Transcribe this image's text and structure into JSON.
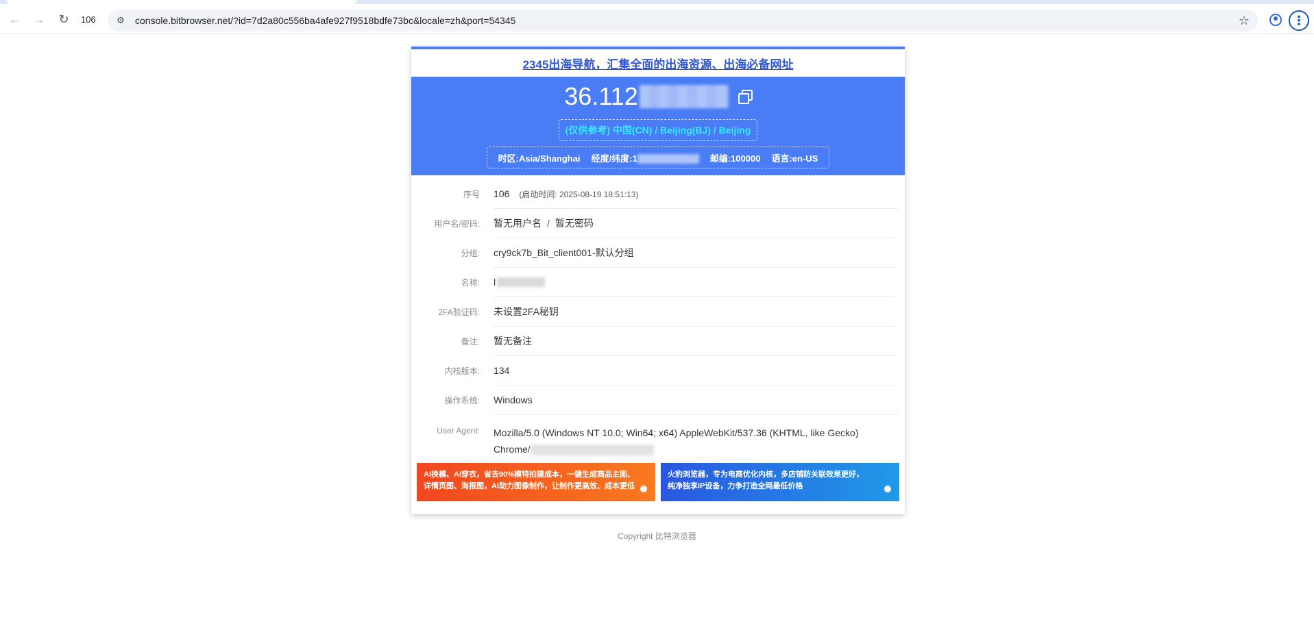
{
  "browser": {
    "tab_number": "106",
    "url": "console.bitbrowser.net/?id=7d2a80c556ba4afe927f9518bdfe73bc&locale=zh&port=54345"
  },
  "card": {
    "top_link": "2345出海导航，汇集全面的出海资源、出海必备网址",
    "ip_prefix": "36.112",
    "location": "(仅供参考) 中国(CN) / Beijing(BJ) / Beijing",
    "timezone": "时区:Asia/Shanghai",
    "coords_prefix": "经度/纬度:1",
    "postcode": "邮编:100000",
    "language": "语言:en-US"
  },
  "details": {
    "seq_label": "序号",
    "seq_value": "106",
    "seq_time": "(启动时间: 2025-08-19 18:51:13)",
    "cred_label": "用户名/密码:",
    "cred_user": "暂无用户名",
    "cred_sep": "/",
    "cred_pass": "暂无密码",
    "group_label": "分组:",
    "group_value": "cry9ck7b_Bit_client001-默认分组",
    "name_label": "名称:",
    "name_value": "l",
    "twofa_label": "2FA验证码:",
    "twofa_value": "未设置2FA秘钥",
    "note_label": "备注:",
    "note_value": "暂无备注",
    "kernel_label": "内核版本:",
    "kernel_value": "134",
    "os_label": "操作系统:",
    "os_value": "Windows",
    "ua_label": "User Agent:",
    "ua_line1": "Mozilla/5.0 (Windows NT 10.0; Win64; x64) AppleWebKit/537.36 (KHTML, like Gecko)",
    "ua_line2": "Chrome/"
  },
  "ads": {
    "ad1_line1": "AI换模、AI穿衣，省去90%模特拍摄成本，一键生成商品主图、",
    "ad1_line2": "详情页图、海报图，AI助力图像制作，让制作更高效、成本更低",
    "ad2_line1": "火豹浏览器，专为电商优化内核，多店铺防关联效果更好，",
    "ad2_line2": "纯净独享IP设备，力争打造全网最低价格"
  },
  "footer": {
    "copyright": "Copyright 比特浏览器"
  },
  "colors": {
    "accent_blue": "#4a7df5",
    "location_cyan": "#38e8ff",
    "ad_orange": "#f2461f",
    "ad_blue": "#2a57e0"
  }
}
